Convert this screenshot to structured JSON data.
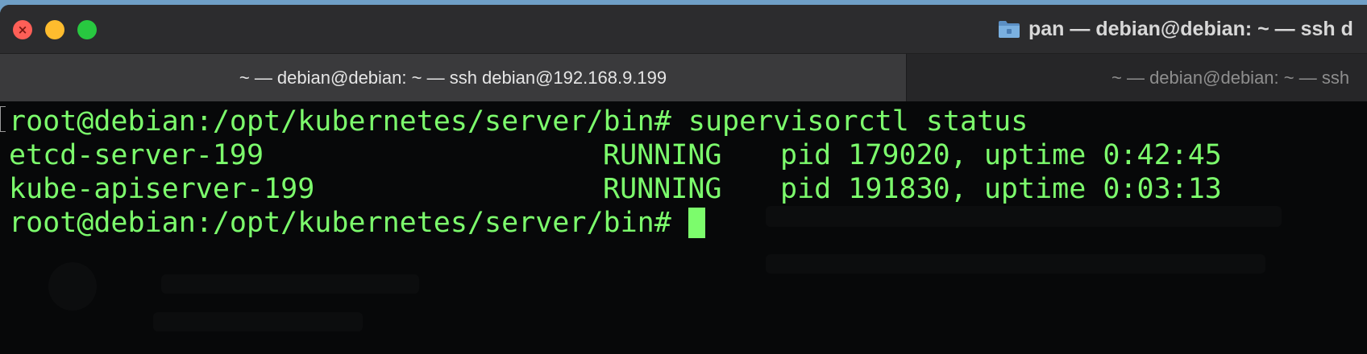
{
  "window": {
    "title": "pan — debian@debian: ~ — ssh d",
    "title_icon": "folder-icon",
    "controls": [
      "close",
      "minimize",
      "maximize"
    ]
  },
  "tabs": [
    {
      "label": "~ — debian@debian: ~ — ssh debian@192.168.9.199",
      "active": true
    },
    {
      "label": "~ — debian@debian: ~ — ssh",
      "active": false
    }
  ],
  "terminal": {
    "command_line": {
      "prompt": "root@debian:/opt/kubernetes/server/bin# ",
      "command": "supervisorctl status"
    },
    "processes": [
      {
        "name": "etcd-server-199",
        "state": "RUNNING",
        "info": "pid 179020, uptime 0:42:45"
      },
      {
        "name": "kube-apiserver-199",
        "state": "RUNNING",
        "info": "pid 191830, uptime 0:03:13"
      }
    ],
    "current_prompt": "root@debian:/opt/kubernetes/server/bin# ",
    "colors": {
      "text": "#7cfc6c",
      "background": "#070809"
    }
  }
}
